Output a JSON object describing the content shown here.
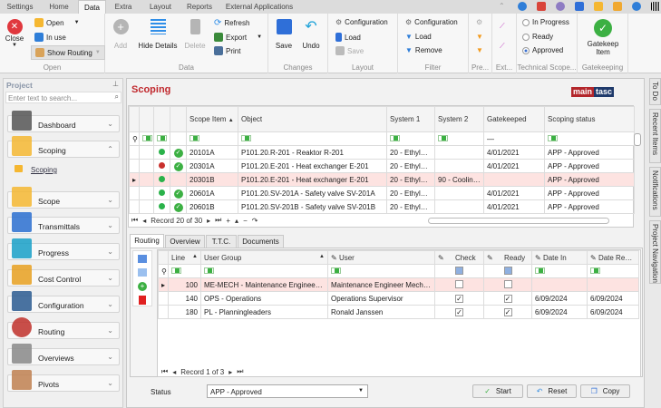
{
  "menu_tabs": [
    "Settings",
    "Home",
    "Data",
    "Extra",
    "Layout",
    "Reports",
    "External Applications"
  ],
  "ribbon": {
    "open": {
      "close": "Close",
      "open": "Open",
      "in_use": "In use",
      "show_routing": "Show Routing",
      "group": "Open"
    },
    "data": {
      "add": "Add",
      "hide_details": "Hide Details",
      "delete": "Delete",
      "refresh": "Refresh",
      "export": "Export",
      "print": "Print",
      "group": "Data"
    },
    "changes": {
      "save": "Save",
      "undo": "Undo",
      "group": "Changes"
    },
    "layout": {
      "configuration": "Configuration",
      "load": "Load",
      "save": "Save",
      "group": "Layout"
    },
    "filter": {
      "configuration": "Configuration",
      "load": "Load",
      "remove": "Remove",
      "group": "Filter"
    },
    "pre": {
      "group": "Pre..."
    },
    "ext": {
      "group": "Ext..."
    },
    "technical_scope": {
      "options": [
        "In Progress",
        "Ready",
        "Approved"
      ],
      "selected": "Approved",
      "group": "Technical Scope..."
    },
    "gatekeeping": {
      "button": "Gatekeep Item",
      "group": "Gatekeeping"
    }
  },
  "left": {
    "title": "Project",
    "search_placeholder": "Enter text to search...",
    "sub_item": "Scoping",
    "items": [
      "Dashboard",
      "Scoping",
      "Scope",
      "Transmittals",
      "Progress",
      "Cost Control",
      "Configuration",
      "Routing",
      "Overviews",
      "Pivots"
    ]
  },
  "main": {
    "title": "Scoping",
    "logo": "maintasc",
    "columns": [
      "Scope Item",
      "Object",
      "System 1",
      "System 2",
      "Gatekeeped",
      "Scoping status"
    ],
    "rows": [
      {
        "dot": "#2ab24a",
        "ok": true,
        "scope": "20101A",
        "object": "P101.20.R-201 - Reaktor R-201",
        "sys1": "20 - Ethylen...",
        "sys2": "",
        "gk": "4/01/2021",
        "status": "APP - Approved"
      },
      {
        "dot": "#c9302c",
        "ok": true,
        "scope": "20301A",
        "object": "P101.20.E-201 - Heat exchanger E-201",
        "sys1": "20 - Ethylen...",
        "sys2": "",
        "gk": "4/01/2021",
        "status": "APP - Approved"
      },
      {
        "dot": "#2ab24a",
        "ok": false,
        "scope": "20301B",
        "object": "P101.20.E-201 - Heat exchanger E-201",
        "sys1": "20 - Ethylen...",
        "sys2": "90 - Cooling...",
        "gk": "",
        "status": "APP - Approved"
      },
      {
        "dot": "#2ab24a",
        "ok": true,
        "scope": "20601A",
        "object": "P101.20.SV-201A - Safety valve SV-201A",
        "sys1": "20 - Ethylen...",
        "sys2": "",
        "gk": "4/01/2021",
        "status": "APP - Approved"
      },
      {
        "dot": "#2ab24a",
        "ok": true,
        "scope": "20601B",
        "object": "P101.20.SV-201B - Safety valve SV-201B",
        "sys1": "20 - Ethylen...",
        "sys2": "",
        "gk": "4/01/2021",
        "status": "APP - Approved"
      }
    ],
    "record": "Record 20 of 30"
  },
  "detail": {
    "tabs": [
      "Routing",
      "Overview",
      "T.T.C.",
      "Documents"
    ],
    "columns": [
      "Line",
      "User Group",
      "User",
      "Check",
      "Ready",
      "Date In",
      "Date Ready"
    ],
    "rows": [
      {
        "line": "100",
        "group": "ME-MECH - Maintenance Engineers - ...",
        "user": "Maintenance Engineer Mechan...",
        "check": false,
        "ready": false,
        "date_in": "",
        "date_ready": ""
      },
      {
        "line": "140",
        "group": "OPS - Operations",
        "user": "Operations Supervisor",
        "check": true,
        "ready": true,
        "date_in": "6/09/2024",
        "date_ready": "6/09/2024"
      },
      {
        "line": "180",
        "group": "PL - Planningleaders",
        "user": "Ronald Janssen",
        "check": true,
        "ready": true,
        "date_in": "6/09/2024",
        "date_ready": "6/09/2024"
      }
    ],
    "record": "Record 1 of 3",
    "status_label": "Status",
    "status_value": "APP - Approved",
    "start": "Start",
    "reset": "Reset",
    "copy": "Copy"
  },
  "side_tabs": [
    "To Do",
    "Recent Items",
    "Notifications",
    "Project Navigation"
  ]
}
